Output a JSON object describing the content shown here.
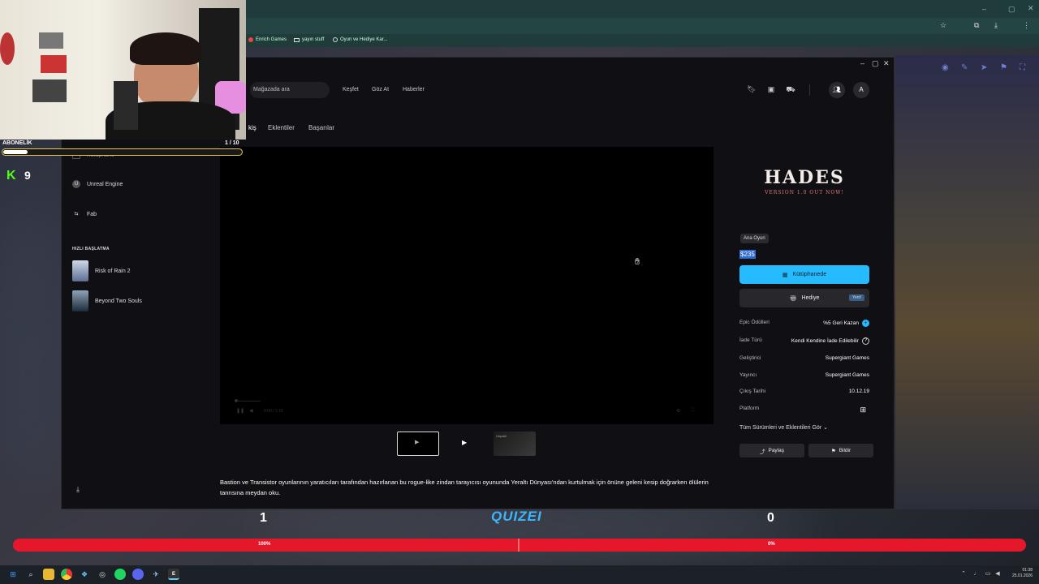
{
  "bookmarks": [
    {
      "label": "Enrich Games"
    },
    {
      "label": "yayın stuff"
    },
    {
      "label": "Oyun ve Hediye Kar..."
    }
  ],
  "epic": {
    "search_placeholder": "Mağazada ara",
    "nav": [
      "Keşfet",
      "Göz At",
      "Haberler"
    ],
    "tabs": [
      "kiş",
      "Eklentiler",
      "Başarılar"
    ],
    "avatar_letter": "A",
    "sidebar": {
      "top_item": "Kütüphane",
      "items": [
        "Unreal Engine",
        "Fab"
      ],
      "quick_start_label": "HIZLI BAŞLATMA",
      "quick_items": [
        "Risk of Rain 2",
        "Beyond Two Souls"
      ]
    },
    "video_time": "0:00 / 1:19",
    "thumb_label": "Unpaid",
    "game": {
      "logo": "HADES",
      "logo_sub": "VERSION 1.0 OUT NOW!",
      "badge": "Ana Oyun",
      "price": "$235",
      "library_button": "Kütüphanede",
      "gift_button": "Hediye",
      "new_tag": "Yeni!",
      "info": [
        {
          "label": "Epic Ödülleri",
          "value": "%5 Geri Kazan"
        },
        {
          "label": "İade Türü",
          "value": "Kendi Kendine İade Edilebilir"
        },
        {
          "label": "Geliştirici",
          "value": "Supergiant Games"
        },
        {
          "label": "Yayıncı",
          "value": "Supergiant Games"
        },
        {
          "label": "Çıkış Tarihi",
          "value": "10.12.19"
        },
        {
          "label": "Platform",
          "value": ""
        }
      ],
      "versions_link": "Tüm Sürümleri ve Eklentileri Gör",
      "share_button": "Paylaş",
      "report_button": "Bildir",
      "description": "Bastion ve Transistor oyunlarının yaratıcıları tarafından hazırlanan bu rogue-like zindan tarayıcısı oyununda Yeraltı Dünyası'ndan kurtulmak için önüne geleni kesip doğrarken ölülerin tanrısına meydan oku."
    }
  },
  "overlay": {
    "sub_label": "ABONELİK",
    "sub_count": "1 / 10",
    "sub_progress": 0.1,
    "kick_logo": "K",
    "kick_count": "9",
    "score_left": "1",
    "score_right": "0",
    "quiz_logo": "QUIZEI",
    "vote_left_pct": "100%",
    "vote_right_pct": "0%"
  },
  "taskbar": {
    "time": "01:38",
    "date": "25.01.2026"
  }
}
